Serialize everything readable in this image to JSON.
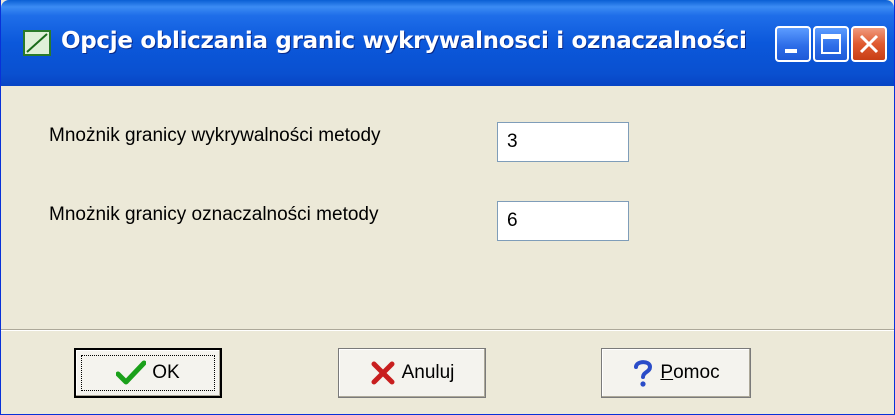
{
  "window": {
    "title": "Opcje obliczania granic wykrywalnosci i oznaczalności"
  },
  "form": {
    "detection_label": "Mnożnik granicy wykrywalności metody",
    "detection_value": "3",
    "quantification_label": "Mnożnik granicy oznaczalności metody",
    "quantification_value": "6"
  },
  "buttons": {
    "ok_label": "OK",
    "cancel_label": "Anuluj",
    "help_label_underlined": "P",
    "help_label_rest": "omoc"
  },
  "icons": {
    "ok": "checkmark-icon",
    "cancel": "x-icon",
    "help": "question-mark-icon",
    "app": "chart-line-icon"
  },
  "colors": {
    "titlebar": "#0a5fd4",
    "dialog_bg": "#ece9d8",
    "ok_icon": "#1aa01a",
    "cancel_icon": "#c81e1e",
    "help_icon": "#2a4cc8"
  }
}
